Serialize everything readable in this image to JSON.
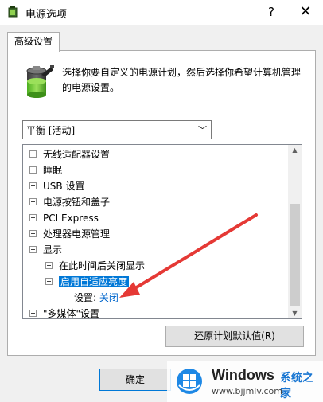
{
  "window": {
    "title": "电源选项",
    "help_label": "?",
    "close_label": "✕"
  },
  "tabs": [
    {
      "label": "高级设置"
    }
  ],
  "description": "选择你要自定义的电源计划，然后选择你希望计算机管理的电源设置。",
  "plan_dropdown": {
    "value": "平衡 [活动]",
    "chevron": "﹀"
  },
  "tree": {
    "items": [
      {
        "label": "无线适配器设置"
      },
      {
        "label": "睡眠"
      },
      {
        "label": "USB 设置"
      },
      {
        "label": "电源按钮和盖子"
      },
      {
        "label": "PCI Express"
      },
      {
        "label": "处理器电源管理"
      },
      {
        "label": "显示"
      },
      {
        "label": "在此时间后关闭显示"
      },
      {
        "label": "启用自适应亮度"
      },
      {
        "label": "\"多媒体\"设置"
      }
    ],
    "setting_label": "设置:",
    "setting_value": "关闭"
  },
  "buttons": {
    "restore": "还原计划默认值(R)",
    "ok": "确定"
  },
  "watermark": {
    "brand": "Windows",
    "tagline": "系统之家",
    "url": "www.bjjmlv.com"
  },
  "colors": {
    "selection": "#0078d7",
    "arrow": "#e53935",
    "link": "#0066cc"
  }
}
